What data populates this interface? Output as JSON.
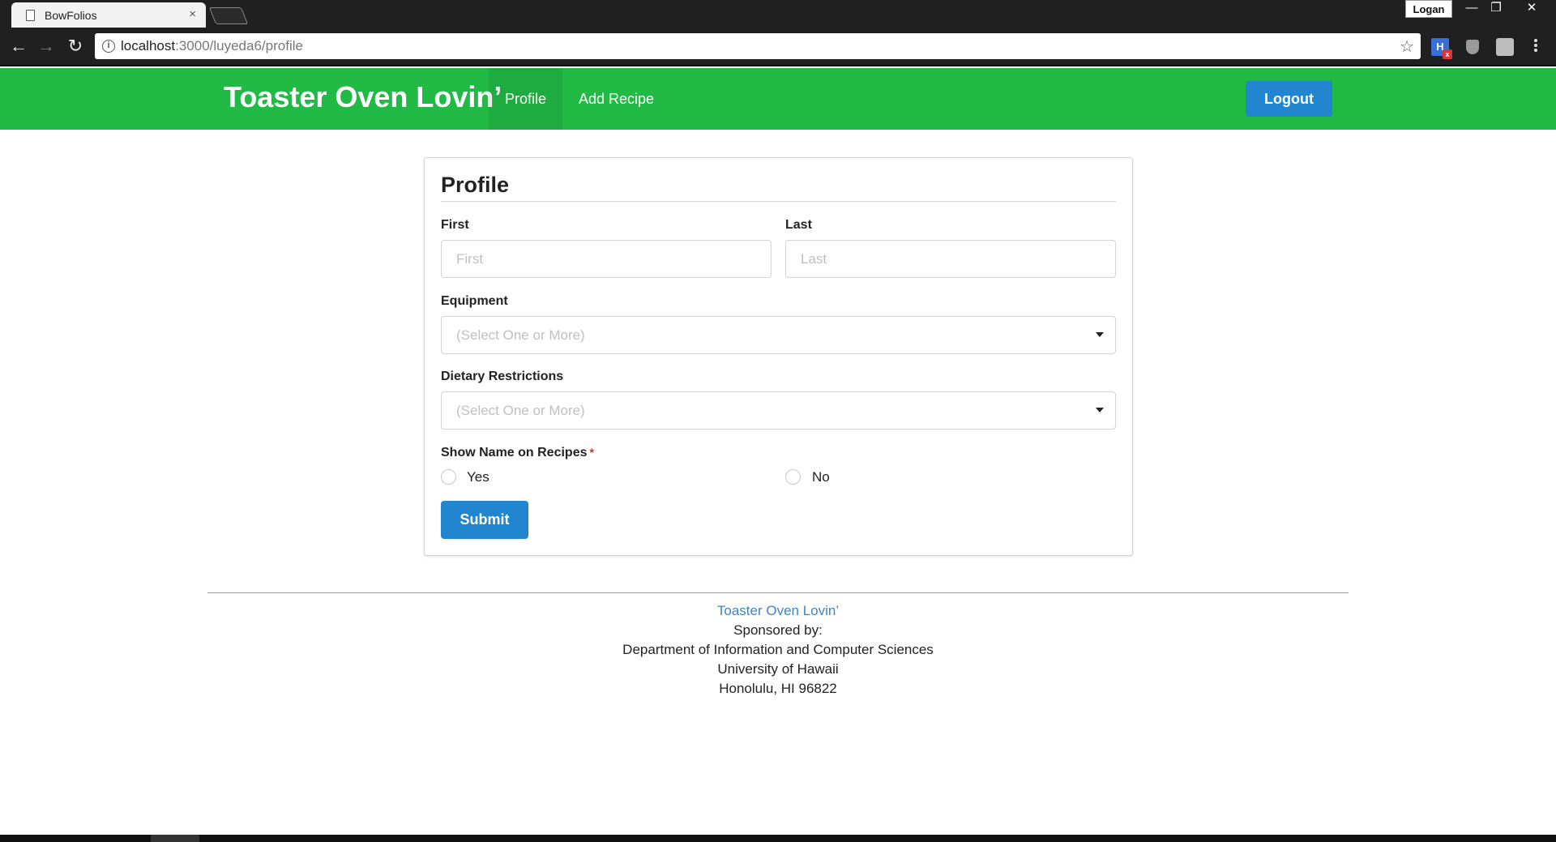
{
  "browser": {
    "tab_title": "BowFolios",
    "tab_close": "×",
    "profile_name": "Logan",
    "window_controls": {
      "minimize": "—",
      "restore": "❐",
      "close": "✕"
    },
    "back": "←",
    "forward": "→",
    "reload": "↻",
    "info_glyph": "i",
    "url_host": "localhost",
    "url_rest": ":3000/luyeda6/profile",
    "star": "☆",
    "extension_1": "H",
    "extension_1_badge": "x"
  },
  "navbar": {
    "brand": "Toaster Oven Lovin’",
    "items": [
      {
        "label": "Profile",
        "active": true
      },
      {
        "label": "Add Recipe",
        "active": false
      }
    ],
    "logout_label": "Logout",
    "color": "#21ba45"
  },
  "form": {
    "title": "Profile",
    "first": {
      "label": "First",
      "placeholder": "First",
      "value": ""
    },
    "last": {
      "label": "Last",
      "placeholder": "Last",
      "value": ""
    },
    "equipment": {
      "label": "Equipment",
      "placeholder": "(Select One or More)"
    },
    "dietary": {
      "label": "Dietary Restrictions",
      "placeholder": "(Select One or More)"
    },
    "show_name": {
      "label": "Show Name on Recipes",
      "required_mark": "*",
      "options": [
        "Yes",
        "No"
      ]
    },
    "submit_label": "Submit",
    "button_color": "#2185d0"
  },
  "footer": {
    "link": "Toaster Oven Lovin’",
    "lines": [
      "Sponsored by:",
      "Department of Information and Computer Sciences",
      "University of Hawaii",
      "Honolulu, HI 96822"
    ]
  }
}
